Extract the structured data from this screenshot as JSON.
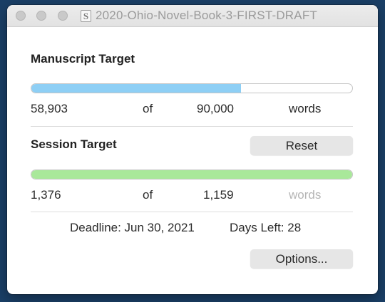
{
  "window": {
    "title": "2020-Ohio-Novel-Book-3-FIRST-DRAFT",
    "doc_icon_glyph": "S"
  },
  "manuscript": {
    "heading": "Manuscript Target",
    "current": "58,903",
    "of_label": "of",
    "target": "90,000",
    "unit": "words",
    "progress_fraction": 0.654,
    "bar_color": "#8ecff5"
  },
  "session": {
    "heading": "Session Target",
    "reset_label": "Reset",
    "current": "1,376",
    "of_label": "of",
    "target": "1,159",
    "unit": "words",
    "progress_fraction": 1.0,
    "bar_color": "#a9e89a"
  },
  "deadline": {
    "text": "Deadline: Jun 30, 2021",
    "days_left": "Days Left: 28"
  },
  "footer": {
    "options_label": "Options..."
  },
  "colors": {
    "background": "#1a3f66",
    "window": "#ffffff",
    "muted_text": "#b5b5b5"
  }
}
